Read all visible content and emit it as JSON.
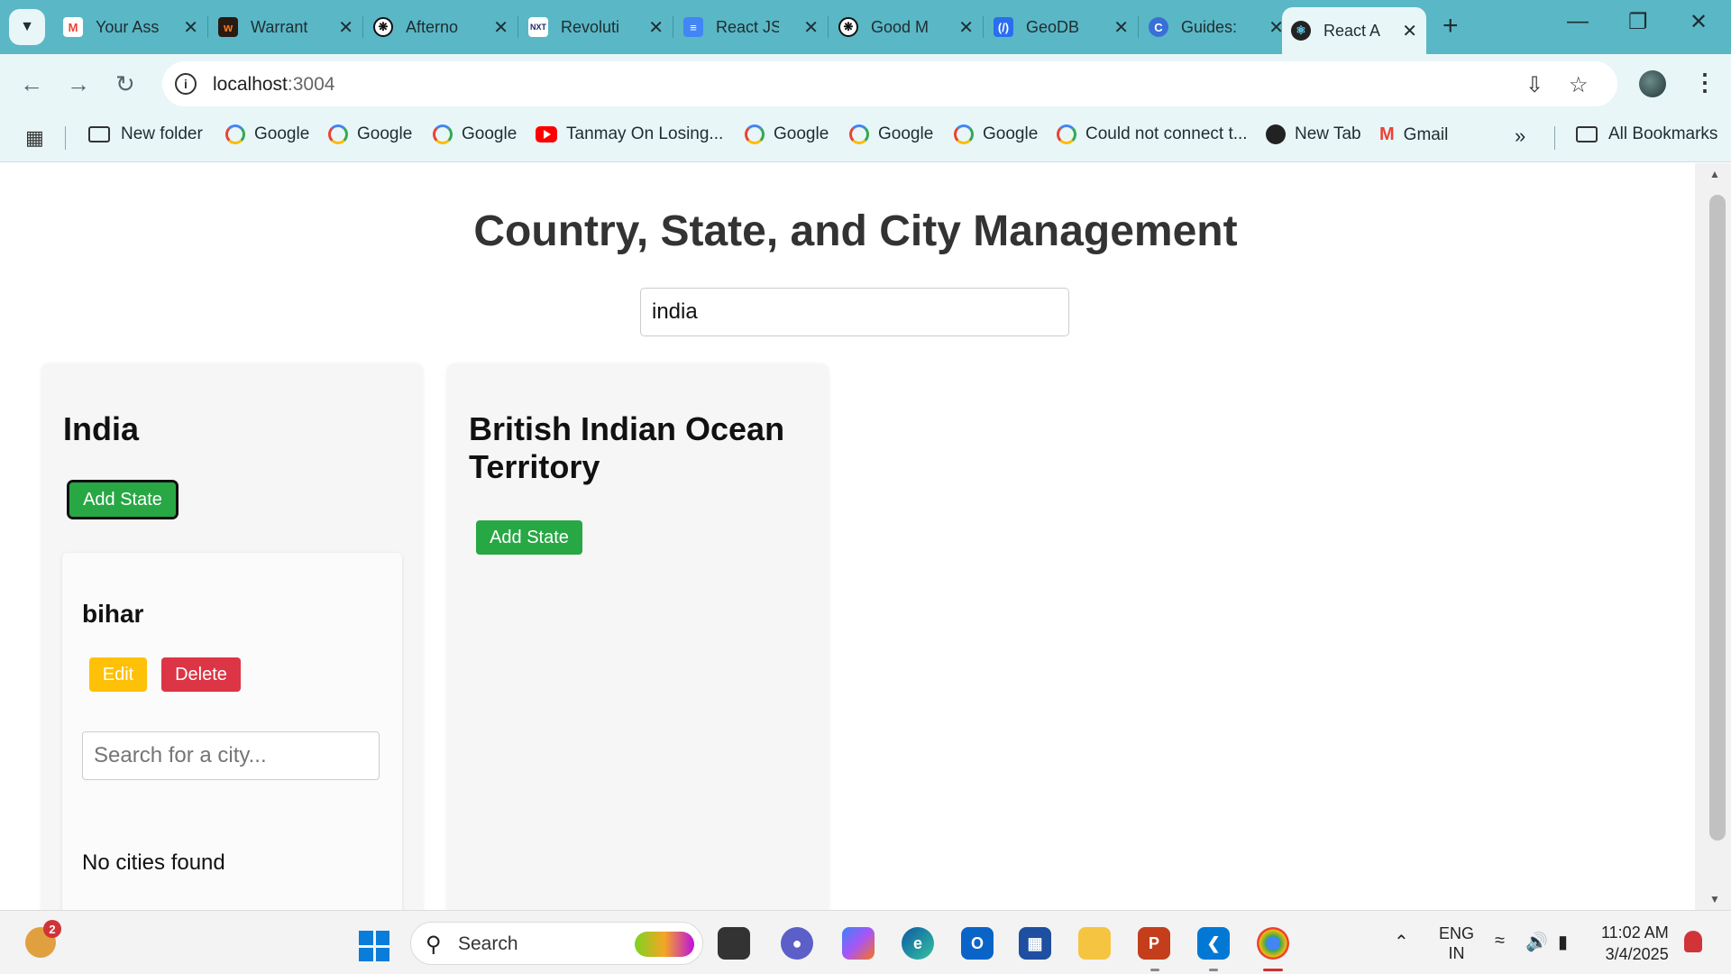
{
  "browser": {
    "tabs": [
      {
        "title": "Your Ass",
        "icon": "gmail-icon"
      },
      {
        "title": "Warrant",
        "icon": "warranty-icon"
      },
      {
        "title": "Afterno",
        "icon": "chatgpt-icon"
      },
      {
        "title": "Revoluti",
        "icon": "nxtwave-icon"
      },
      {
        "title": "React JS",
        "icon": "docs-icon"
      },
      {
        "title": "Good M",
        "icon": "chatgpt-icon"
      },
      {
        "title": "GeoDB",
        "icon": "geodb-icon"
      },
      {
        "title": "Guides:",
        "icon": "guides-icon"
      },
      {
        "title": "React A",
        "icon": "react-icon",
        "active": true
      }
    ],
    "url_host": "localhost",
    "url_port": ":3004",
    "bookmarks": [
      {
        "label": "New folder",
        "icon": "folder-icon"
      },
      {
        "label": "Google",
        "icon": "google-icon"
      },
      {
        "label": "Google",
        "icon": "google-icon"
      },
      {
        "label": "Google",
        "icon": "google-icon"
      },
      {
        "label": "Tanmay On Losing...",
        "icon": "youtube-icon"
      },
      {
        "label": "Google",
        "icon": "google-icon"
      },
      {
        "label": "Google",
        "icon": "google-icon"
      },
      {
        "label": "Google",
        "icon": "google-icon"
      },
      {
        "label": "Could not connect t...",
        "icon": "google-icon"
      },
      {
        "label": "New Tab",
        "icon": "globe-icon"
      },
      {
        "label": "Gmail",
        "icon": "gmail-icon"
      }
    ],
    "all_bookmarks": "All Bookmarks"
  },
  "app": {
    "title": "Country, State, and City Management",
    "country_search_value": "india",
    "add_state_label": "Add State",
    "countries": [
      {
        "name": "India",
        "states": [
          {
            "name": "bihar",
            "edit_label": "Edit",
            "delete_label": "Delete",
            "city_search_placeholder": "Search for a city...",
            "empty_text": "No cities found"
          }
        ]
      },
      {
        "name": "British Indian Ocean Territory",
        "states": []
      }
    ]
  },
  "taskbar": {
    "weather_badge": "2",
    "search_label": "Search",
    "lang_line1": "ENG",
    "lang_line2": "IN",
    "time": "11:02 AM",
    "date": "3/4/2025"
  },
  "colors": {
    "tab_strip": "#5ab7c6",
    "toolbar": "#e8f6f8",
    "green": "#28a745",
    "yellow": "#ffc107",
    "red": "#dc3545"
  }
}
